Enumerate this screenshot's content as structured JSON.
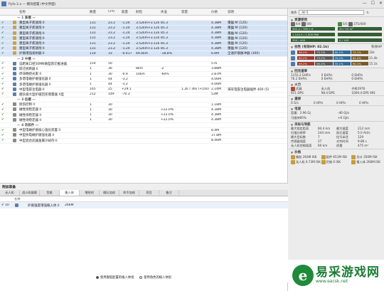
{
  "window": {
    "title": "Pyfa 2.x — 模块配置 (中文界面)",
    "controls": [
      "—",
      "☐",
      "✕"
    ]
  },
  "ship_preset": "All 5",
  "module_columns": [
    "名称",
    "数量",
    "CPU",
    "能量",
    "射程",
    "失准",
    "容量",
    "价格",
    "说明"
  ],
  "group_1_title": "— 1 高槽 —",
  "group_2_title": "— 2 中槽 —",
  "group_3_title": "— 3 低槽 —",
  "group_4_title": "— 4 改装件 —",
  "modules_high": [
    {
      "name": "重型离子疾速炮 II",
      "a": "131",
      "b": "23.2",
      "c": "-1.24",
      "d": "3.52km+3.12km",
      "e": "85.3",
      "f": "",
      "g": "4.38M",
      "h": "重幽 M (120)"
    },
    {
      "name": "重型离子疾速炮 II",
      "a": "131",
      "b": "23.2",
      "c": "-1.24",
      "d": "3.52km+3.12km",
      "e": "85.3",
      "f": "",
      "g": "4.38M",
      "h": "重幽 M (120)"
    },
    {
      "name": "重型离子疾速炮 II",
      "a": "131",
      "b": "23.2",
      "c": "-1.24",
      "d": "3.52km+3.12km",
      "e": "85.3",
      "f": "",
      "g": "4.38M",
      "h": "重幽 M (120)"
    },
    {
      "name": "重型离子疾速炮 II",
      "a": "131",
      "b": "23.2",
      "c": "-1.24",
      "d": "3.52km+3.12km",
      "e": "85.3",
      "f": "",
      "g": "4.38M",
      "h": "重幽 M (120)"
    },
    {
      "name": "重型离子疾速炮 II",
      "a": "131",
      "b": "23.2",
      "c": "-1.24",
      "d": "3.52km+3.12km",
      "e": "85.3",
      "f": "",
      "g": "4.38M",
      "h": "重幽 M (120)"
    },
    {
      "name": "重型离子疾速炮 II",
      "a": "131",
      "b": "23.2",
      "c": "-1.24",
      "d": "3.52km+3.12km",
      "e": "85.3",
      "f": "",
      "g": "4.38M",
      "h": "重幽 M (120)"
    },
    {
      "name": "护盾增强发射器 II",
      "a": "110",
      "b": "33",
      "c": "-0.417",
      "d": "49.4km",
      "e": "-18.8%",
      "f": "",
      "g": "6.6M",
      "h": "全速护盾脉冲器 (300)"
    }
  ],
  "modules_mid": [
    {
      "name": "远距离口径50MN微型跃迁推进器",
      "a": "150",
      "b": "50",
      "c": "",
      "d": "",
      "e": "",
      "f": "",
      "g": "57k",
      "h": ""
    },
    {
      "name": "跃迁扰断器 II",
      "a": "1",
      "b": "36",
      "c": "",
      "d": "8km",
      "e": "-2",
      "f": "",
      "g": "3.88M",
      "h": ""
    },
    {
      "name": "停滞缠绕光束 II",
      "a": "1",
      "b": "30",
      "c": "-0.9",
      "d": "10km",
      "e": "-60%",
      "f": "",
      "g": "2.87M",
      "h": ""
    },
    {
      "name": "多谱电磁护盾强化器 II",
      "a": "1",
      "b": "44",
      "c": "-3.2",
      "d": "",
      "e": "",
      "f": "",
      "g": "4.06M",
      "h": ""
    },
    {
      "name": "多谱电磁护盾强化器 II",
      "a": "1",
      "b": "44",
      "c": "-3.2",
      "d": "",
      "e": "",
      "f": "",
      "g": "4.06M",
      "h": ""
    },
    {
      "name": "中型电容注电器 II",
      "a": "165",
      "b": "25",
      "c": "+29.1",
      "d": "",
      "e": "",
      "f": "1.2k / 36s (+10s)",
      "g": "2.24M",
      "h": "海军电容注电器插件 400 (5)"
    },
    {
      "name": "舰队级大型护盾回充增量器 X型",
      "a": "212",
      "b": "149",
      "c": "-70.3",
      "d": "",
      "e": "",
      "f": "",
      "g": "53M",
      "h": ""
    }
  ],
  "modules_low": [
    {
      "name": "损伤控制 II",
      "a": "1",
      "b": "30",
      "c": "",
      "d": "",
      "e": "",
      "f": "",
      "g": "1.18M",
      "h": ""
    },
    {
      "name": "磁性场稳定器 II",
      "a": "1",
      "b": "30",
      "c": "",
      "d": "",
      "e": "+22.0%",
      "f": "",
      "g": "4.38M",
      "h": ""
    },
    {
      "name": "磁性场稳定器 II",
      "a": "1",
      "b": "30",
      "c": "",
      "d": "",
      "e": "+22.0%",
      "f": "",
      "g": "4.38M",
      "h": ""
    },
    {
      "name": "磁性场稳定器 II",
      "a": "1",
      "b": "30",
      "c": "",
      "d": "",
      "e": "+22.0%",
      "f": "",
      "g": "4.38M",
      "h": ""
    }
  ],
  "modules_rigs": [
    {
      "name": "中型电磁护盾核心强化装置 II",
      "a": "",
      "b": "",
      "c": "",
      "d": "",
      "e": "",
      "f": "",
      "g": "8.4M",
      "h": ""
    },
    {
      "name": "中型抗电磁护盾强化器 II",
      "a": "",
      "b": "",
      "c": "",
      "d": "",
      "e": "",
      "f": "",
      "g": "37.8M",
      "h": ""
    },
    {
      "name": "中型混合武器金属冷却剂 II",
      "a": "",
      "b": "",
      "c": "",
      "d": "",
      "e": "",
      "f": "",
      "g": "8.46M",
      "h": ""
    }
  ],
  "fitting": {
    "title": "附加装备",
    "tabs": [
      "无人机",
      "战斗机舰载",
      "货舱",
      "植入体",
      "增效剂",
      "舰队加成",
      "命令加成",
      "项目",
      "备注"
    ],
    "active_tab": 3,
    "columns": [
      "",
      "名称",
      "",
      "数量",
      "",
      "价格"
    ],
    "row": {
      "qty": "10",
      "name": "护盾强度增强植入体 II",
      "price": "266M"
    },
    "radio_1": "使用舰船配置的植入体组",
    "radio_2": "使用角色的植入体组"
  },
  "stats": {
    "preset_label": "角色",
    "preset_value": "All 5",
    "res_title": "资源使用",
    "res_turrets": "4/4",
    "res_launchers": "0/0",
    "res_drones": "5/5",
    "res_bay": "375/400",
    "res_cpu": "492.2 / 706.1 tf",
    "res_grid": "20 / 25 m³",
    "res_pg": "1,144.5 / 1,505 MW",
    "res_bw": "",
    "res_cal": "350 / 400",
    "res_cargo": "0 / 145",
    "ehp_title": "抗性 (有效HP: 82.1k)",
    "ehp_label": "有效HP",
    "res_rows": [
      {
        "a": "48.2%",
        "b": "75.2%",
        "c": "60.2%",
        "d": "74.1%",
        "hp": "32k"
      },
      {
        "a": "60.2%",
        "b": "75.2%",
        "c": "70.2%",
        "d": "84.4%",
        "hp": "11.4k"
      },
      {
        "a": "46.2%",
        "b": "60.2%",
        "c": "55.1%",
        "d": "90.1%",
        "hp": "15.1k"
      }
    ],
    "rep_title": "回充速率",
    "rep_1": "1155.2 EHP/s",
    "rep_2": "0 EHP/s",
    "rep_3": "0 EHP/s",
    "rep_4": "76.2 EHP/s",
    "rep_5": "0 EHP/s",
    "rep_6": "0 EHP/s",
    "fire_title": "火力",
    "fire_w_label": "武器",
    "fire_w": "911 DPS",
    "fire_d_label": "无人机",
    "fire_d": "98.4 DPS",
    "fire_t_label": "齐射2976",
    "fire_t": "1009.4 DPS",
    "fire_v": "991",
    "rr_title": "遥修",
    "rr_1": "0 G/s",
    "rr_2": "0 HP/s",
    "rr_3": "0 HP/s",
    "rr_4": "0 HP/s",
    "cap_title": "电容",
    "cap_1": "容量：2.96 GJ",
    "cap_2": "可维持85%",
    "cap_3": "-46 GJ/s",
    "cap_4": "+6 GJ/s",
    "nav_title": "目标与导航",
    "nav_rows": [
      {
        "k": "最大锁定距离",
        "v": "84.4 km",
        "k2": "最大速度",
        "v2": "212 m/s"
      },
      {
        "k": "扫描分辨率",
        "v": "244 mm",
        "k2": "跃迁速度",
        "v2": "5.0 AU/s"
      },
      {
        "k": "最大目标数",
        "v": "7",
        "k2": "信号半径",
        "v2": "129"
      },
      {
        "k": "传感器强度",
        "v": "27",
        "k2": "对齐时间",
        "v2": "9.86 s"
      },
      {
        "k": "无人机控制距离",
        "v": "60 km",
        "k2": "质量",
        "v2": "475 m³"
      }
    ],
    "price_title": "价格",
    "price_rows": [
      {
        "k": "舰船",
        "v": "264M ISK",
        "k2": "配件",
        "v2": "651M ISK",
        "k3": "总计",
        "v3": "350M ISK"
      },
      {
        "k": "无人机",
        "v": "6.73M ISK",
        "k2": "货舱",
        "v2": "0 ISK",
        "k3": "植入体",
        "v3": "266M ISK"
      }
    ]
  },
  "watermark": {
    "cn": "易采游戏网",
    "url": "www.eacsk.net",
    "mark": "e"
  }
}
